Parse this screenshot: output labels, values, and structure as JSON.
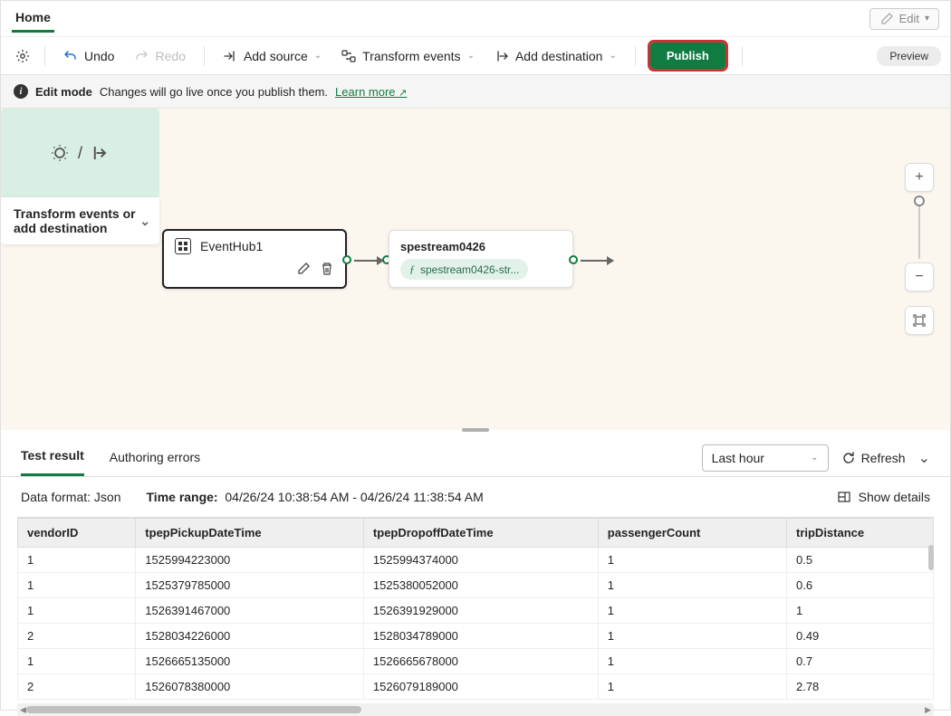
{
  "header": {
    "tab": "Home",
    "edit": "Edit"
  },
  "toolbar": {
    "undo": "Undo",
    "redo": "Redo",
    "add_source": "Add source",
    "transform": "Transform events",
    "add_dest": "Add destination",
    "publish": "Publish",
    "preview": "Preview"
  },
  "notice": {
    "mode": "Edit mode",
    "msg": "Changes will go live once you publish them.",
    "learn": "Learn more"
  },
  "canvas": {
    "node1": {
      "title": "EventHub1"
    },
    "node2": {
      "title": "spestream0426",
      "pill": "spestream0426-str..."
    },
    "node3": {
      "label": "Transform events or add destination"
    }
  },
  "panel": {
    "tab1": "Test result",
    "tab2": "Authoring errors",
    "time_sel": "Last hour",
    "refresh": "Refresh",
    "format_label": "Data format:",
    "format_val": "Json",
    "range_label": "Time range:",
    "range_val": "04/26/24 10:38:54 AM - 04/26/24 11:38:54 AM",
    "show_details": "Show details"
  },
  "table": {
    "cols": [
      "vendorID",
      "tpepPickupDateTime",
      "tpepDropoffDateTime",
      "passengerCount",
      "tripDistance"
    ],
    "rows": [
      [
        "1",
        "1525994223000",
        "1525994374000",
        "1",
        "0.5"
      ],
      [
        "1",
        "1525379785000",
        "1525380052000",
        "1",
        "0.6"
      ],
      [
        "1",
        "1526391467000",
        "1526391929000",
        "1",
        "1"
      ],
      [
        "2",
        "1528034226000",
        "1528034789000",
        "1",
        "0.49"
      ],
      [
        "1",
        "1526665135000",
        "1526665678000",
        "1",
        "0.7"
      ],
      [
        "2",
        "1526078380000",
        "1526079189000",
        "1",
        "2.78"
      ]
    ]
  }
}
